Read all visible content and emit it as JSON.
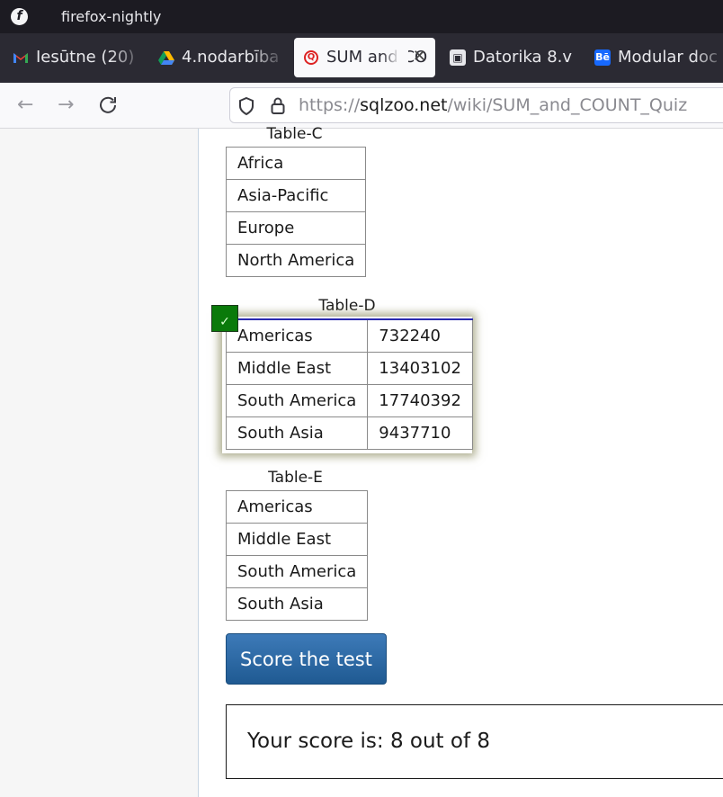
{
  "browser": {
    "app_name": "firefox-nightly",
    "tabs": [
      {
        "label": "Iesūtne (20)",
        "icon": "gmail-icon"
      },
      {
        "label": "4.nodarbība",
        "icon": "google-drive-icon"
      },
      {
        "label": "SUM and CO",
        "icon": "sqlzoo-icon",
        "active": true
      },
      {
        "label": "Datorika 8.v",
        "icon": "classroom-icon"
      },
      {
        "label": "Modular doc",
        "icon": "behance-icon"
      }
    ],
    "url_prefix": "https://",
    "url_host": "sqlzoo.net",
    "url_path": "/wiki/SUM_and_COUNT_Quiz"
  },
  "quiz": {
    "table_c": {
      "caption": "Table-C",
      "rows": [
        "Africa",
        "Asia-Pacific",
        "Europe",
        "North America"
      ]
    },
    "table_d": {
      "caption": "Table-D",
      "selected": true,
      "check_mark": "✓",
      "rows": [
        [
          "Americas",
          "732240"
        ],
        [
          "Middle East",
          "13403102"
        ],
        [
          "South America",
          "17740392"
        ],
        [
          "South Asia",
          "9437710"
        ]
      ]
    },
    "table_e": {
      "caption": "Table-E",
      "rows": [
        "Americas",
        "Middle East",
        "South America",
        "South Asia"
      ]
    },
    "score_button": "Score the test",
    "score_result": "Your score is: 8 out of 8"
  },
  "colors": {
    "accent_tab": "#e4583a",
    "correct_badge": "#0a7a0a",
    "button_blue": "#2a6aa5"
  }
}
